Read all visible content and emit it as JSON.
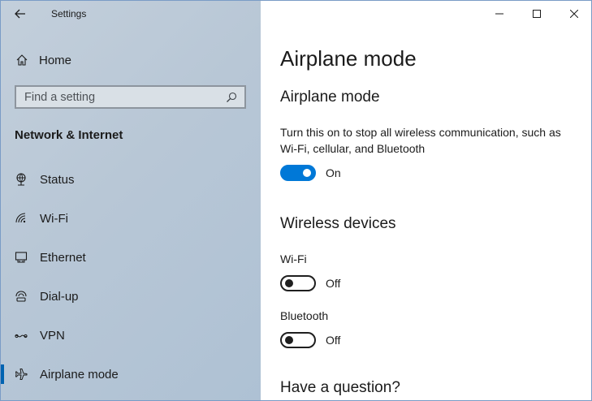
{
  "window": {
    "app_title": "Settings"
  },
  "sidebar": {
    "home_label": "Home",
    "search_placeholder": "Find a setting",
    "section_title": "Network & Internet",
    "items": [
      {
        "label": "Status",
        "icon": "status-icon"
      },
      {
        "label": "Wi-Fi",
        "icon": "wifi-icon"
      },
      {
        "label": "Ethernet",
        "icon": "ethernet-icon"
      },
      {
        "label": "Dial-up",
        "icon": "dial-up-icon"
      },
      {
        "label": "VPN",
        "icon": "vpn-icon"
      },
      {
        "label": "Airplane mode",
        "icon": "airplane-icon",
        "selected": true
      }
    ]
  },
  "main": {
    "page_title": "Airplane mode",
    "airplane_section": {
      "heading": "Airplane mode",
      "description": "Turn this on to stop all wireless communication, such as Wi-Fi, cellular, and Bluetooth",
      "toggle_state": "On"
    },
    "wireless_section": {
      "heading": "Wireless devices",
      "wifi_label": "Wi-Fi",
      "wifi_state": "Off",
      "bluetooth_label": "Bluetooth",
      "bluetooth_state": "Off"
    },
    "help_heading": "Have a question?"
  },
  "colors": {
    "accent": "#0078d7",
    "selection_bar": "#0063b1"
  }
}
